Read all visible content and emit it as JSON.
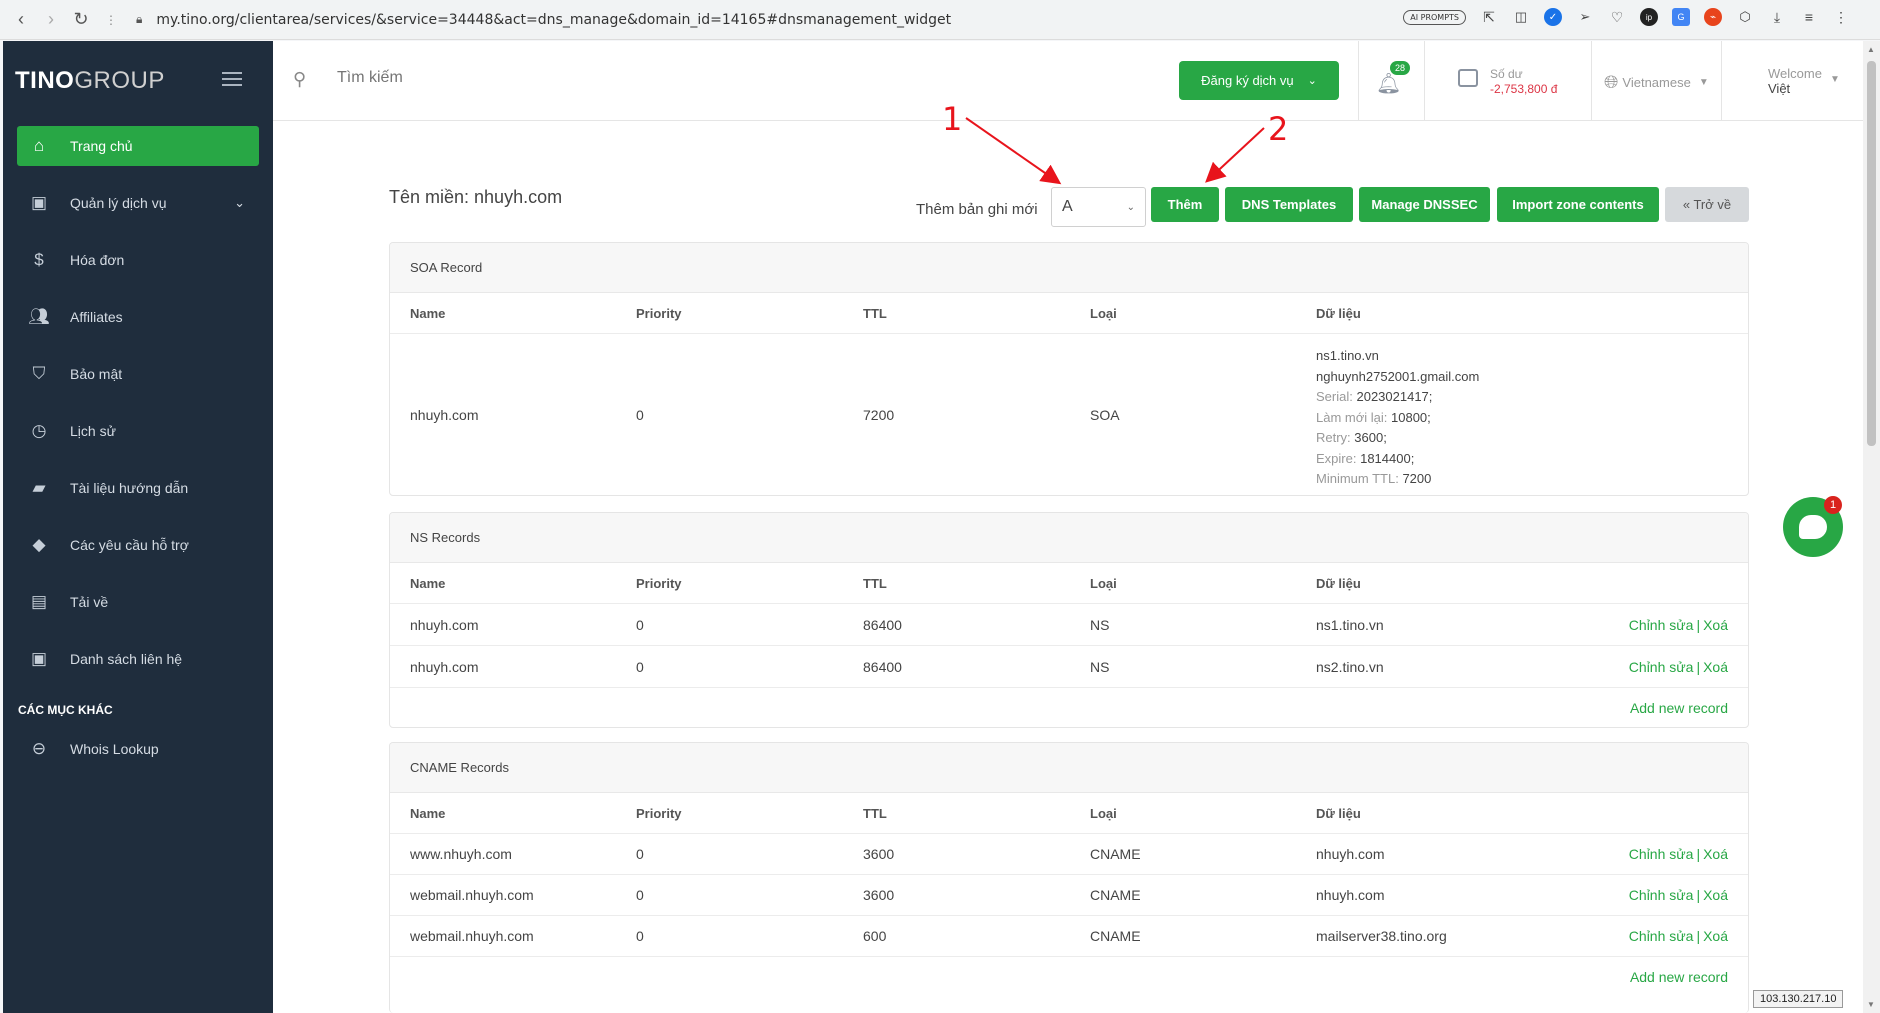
{
  "browser": {
    "url": "my.tino.org/clientarea/services/&service=34448&act=dns_manage&domain_id=14165#dnsmanagement_widget",
    "ai_prompts_label": "AI PROMPTS"
  },
  "sidebar": {
    "logo_left": "TINO",
    "logo_right": "GROUP",
    "items": [
      {
        "label": "Trang chủ",
        "icon": "home-icon"
      },
      {
        "label": "Quản lý dịch vụ",
        "icon": "contact-card-icon"
      },
      {
        "label": "Hóa đơn",
        "icon": "dollar-icon"
      },
      {
        "label": "Affiliates",
        "icon": "users-icon"
      },
      {
        "label": "Bảo mật",
        "icon": "shield-icon"
      },
      {
        "label": "Lịch sử",
        "icon": "history-icon"
      },
      {
        "label": "Tài liệu hướng dẫn",
        "icon": "folder-icon"
      },
      {
        "label": "Các yêu cầu hỗ trợ",
        "icon": "ticket-icon"
      },
      {
        "label": "Tải về",
        "icon": "save-icon"
      },
      {
        "label": "Danh sách liên hệ",
        "icon": "contact-icon"
      }
    ],
    "other_section_title": "CÁC MỤC KHÁC",
    "other_items": [
      {
        "label": "Whois Lookup",
        "icon": "link-icon"
      }
    ]
  },
  "header": {
    "search_placeholder": "Tìm kiếm",
    "register_button": "Đăng ký dịch vụ",
    "notifications_count": "28",
    "balance_label": "Số dư",
    "balance_value": "-2,753,800 đ",
    "language": "Vietnamese",
    "welcome_label": "Welcome",
    "user_name": "Việt"
  },
  "main": {
    "domain_title": "Tên miền: nhuyh.com",
    "new_record_label": "Thêm bản ghi mới",
    "record_type_selected": "A",
    "buttons": {
      "add": "Thêm",
      "dns_templates": "DNS Templates",
      "manage_dnssec": "Manage DNSSEC",
      "import_zone": "Import zone contents",
      "back": "« Trở về"
    },
    "columns": [
      "Name",
      "Priority",
      "TTL",
      "Loại",
      "Dữ liệu"
    ],
    "edit_label": "Chỉnh sửa",
    "delete_label": "Xoá",
    "add_new_record": "Add new record",
    "soa": {
      "title": "SOA Record",
      "name": "nhuyh.com",
      "priority": "0",
      "ttl": "7200",
      "type": "SOA",
      "primary_ns": "ns1.tino.vn",
      "email": "nghuynh2752001.gmail.com",
      "serial_label": "Serial:",
      "serial": "2023021417;",
      "refresh_label": "Làm mới lại:",
      "refresh": "10800;",
      "retry_label": "Retry:",
      "retry": "3600;",
      "expire_label": "Expire:",
      "expire": "1814400;",
      "min_ttl_label": "Minimum TTL:",
      "min_ttl": "7200"
    },
    "ns": {
      "title": "NS Records",
      "rows": [
        {
          "name": "nhuyh.com",
          "priority": "0",
          "ttl": "86400",
          "type": "NS",
          "data": "ns1.tino.vn"
        },
        {
          "name": "nhuyh.com",
          "priority": "0",
          "ttl": "86400",
          "type": "NS",
          "data": "ns2.tino.vn"
        }
      ]
    },
    "cname": {
      "title": "CNAME Records",
      "rows": [
        {
          "name": "www.nhuyh.com",
          "priority": "0",
          "ttl": "3600",
          "type": "CNAME",
          "data": "nhuyh.com"
        },
        {
          "name": "webmail.nhuyh.com",
          "priority": "0",
          "ttl": "3600",
          "type": "CNAME",
          "data": "nhuyh.com"
        },
        {
          "name": "webmail.nhuyh.com",
          "priority": "0",
          "ttl": "600",
          "type": "CNAME",
          "data": "mailserver38.tino.org"
        }
      ]
    }
  },
  "annotations": {
    "one": "1",
    "two": "2"
  },
  "chat": {
    "badge": "1"
  },
  "status_tooltip": "103.130.217.10",
  "colors": {
    "accent_green": "#28a745",
    "sidebar_bg": "#1f2d3d",
    "balance_red": "#dc3545",
    "annotation_red": "#e8141c"
  }
}
